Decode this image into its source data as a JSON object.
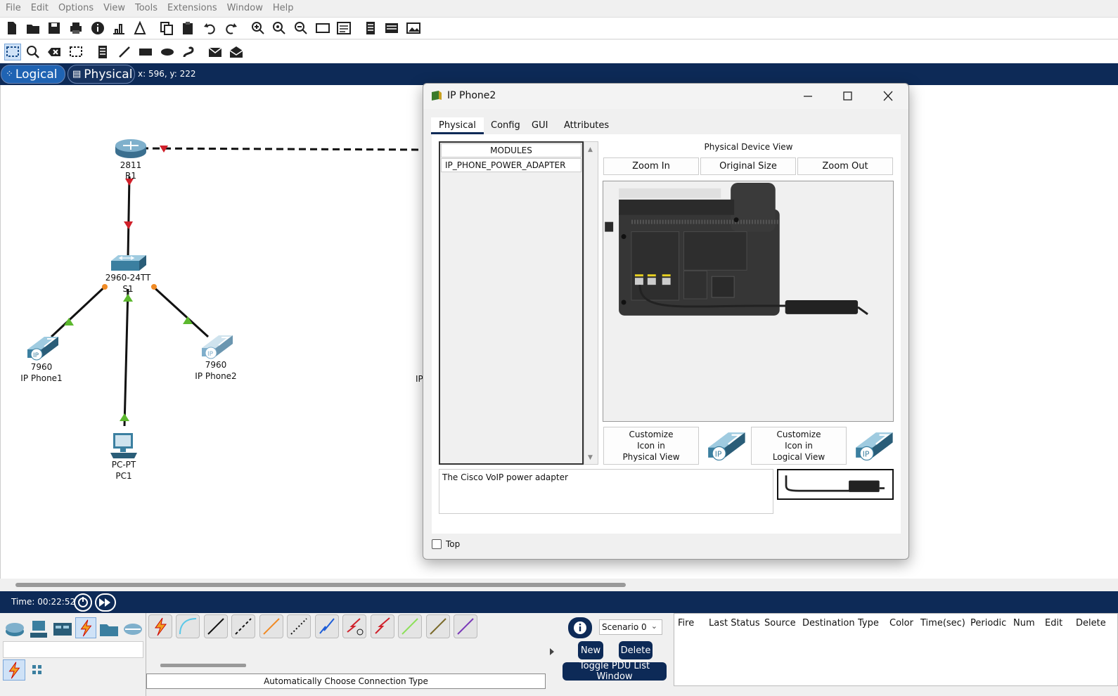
{
  "menu": [
    "File",
    "Edit",
    "Options",
    "View",
    "Tools",
    "Extensions",
    "Window",
    "Help"
  ],
  "nav": {
    "logical_label": "Logical",
    "physical_label": "Physical",
    "coords": "x: 596, y: 222"
  },
  "topology": {
    "router_model": "2811",
    "router_name": "R1",
    "switch_model": "2960-24TT",
    "switch_name": "S1",
    "phone1_model": "7960",
    "phone1_name": "IP Phone1",
    "phone2_model": "7960",
    "phone2_name": "IP Phone2",
    "pc_model": "PC-PT",
    "pc_name": "PC1",
    "hidden_label": "IP"
  },
  "dialog": {
    "title": "IP Phone2",
    "tabs": [
      "Physical",
      "Config",
      "GUI",
      "Attributes"
    ],
    "active_tab": "Physical",
    "modules_header": "MODULES",
    "modules": [
      "IP_PHONE_POWER_ADAPTER"
    ],
    "device_view_title": "Physical Device View",
    "zoom_in": "Zoom In",
    "original_size": "Original Size",
    "zoom_out": "Zoom Out",
    "customize_physical": [
      "Customize",
      "Icon in",
      "Physical View"
    ],
    "customize_logical": [
      "Customize",
      "Icon in",
      "Logical View"
    ],
    "description": "The Cisco VoIP power adapter",
    "top_checkbox_label": "Top",
    "top_checked": false
  },
  "timebar": {
    "time_label": "Time: 00:22:52"
  },
  "bottom": {
    "connection_type_label": "Automatically Choose Connection Type",
    "scenario": "Scenario 0",
    "new_label": "New",
    "delete_label": "Delete",
    "toggle_pdu_label": "Toggle PDU List Window",
    "pdu_columns": [
      "Fire",
      "Last Status",
      "Source",
      "Destination",
      "Type",
      "Color",
      "Time(sec)",
      "Periodic",
      "Num",
      "Edit",
      "Delete"
    ]
  },
  "colors": {
    "nav_bg": "#0d2a57",
    "link_red": "#d0202a",
    "link_green": "#5cb82e",
    "link_orange": "#f08a24"
  }
}
